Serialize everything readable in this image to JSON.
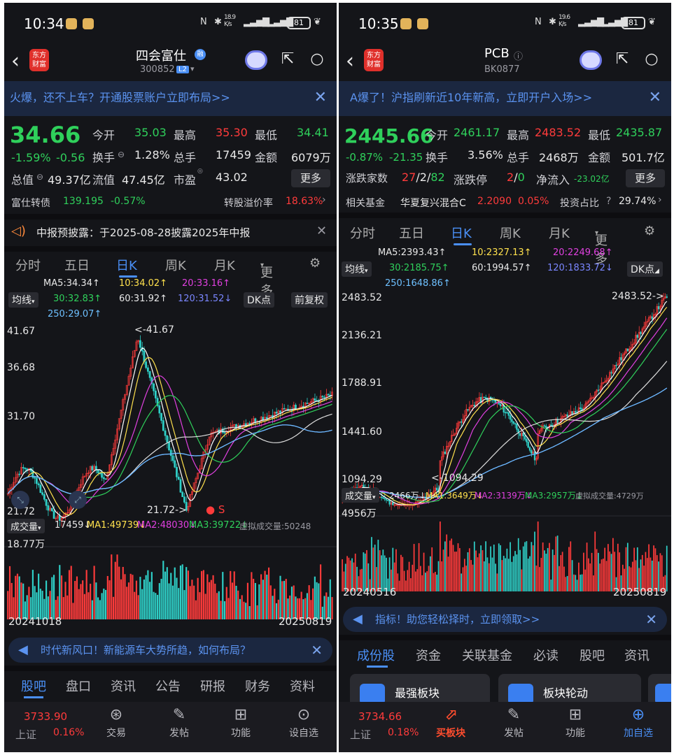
{
  "left": {
    "status": {
      "time": "10:34",
      "speed": "18.9\nK/s",
      "battery": "81"
    },
    "header": {
      "title": "四会富仕",
      "code": "300852",
      "badge_l2": "L2",
      "badge_rong": "融",
      "logo": "东方\n财富"
    },
    "banner": {
      "text": "火爆，还不上车？开通股票账户立即布局>>"
    },
    "quote": {
      "price": "34.66",
      "pct": "-1.59%",
      "chg": "-0.56",
      "open_label": "今开",
      "open": "35.03",
      "high_label": "最高",
      "high": "35.30",
      "low_label": "最低",
      "low": "34.41",
      "turnover_label": "换手",
      "turnover": "1.28%",
      "volume_label": "总手",
      "volume": "17459",
      "amount_label": "金额",
      "amount": "6079万",
      "mcap_label": "总值",
      "mcap": "49.37亿",
      "float_label": "流值",
      "float": "47.45亿",
      "pe_label": "市盈",
      "pe": "43.02",
      "more": "更多"
    },
    "bond": {
      "label": "富仕转债",
      "price": "139.195",
      "pct": "-0.57%",
      "premium_label": "转股溢价率",
      "premium": "18.63%"
    },
    "notice": {
      "text": "中报预披露：于2025-08-28披露2025年中报"
    },
    "tabs": [
      "分时",
      "五日",
      "日K",
      "周K",
      "月K",
      "更多"
    ],
    "ma": {
      "ma5": "MA5:34.34↑",
      "ma10": "10:34.02↑",
      "ma20": "20:33.16↑",
      "ma30": "30:32.83↑",
      "ma60": "60:31.92↑",
      "ma120": "120:31.52↓",
      "ma250": "250:29.07↑"
    },
    "pills": {
      "line": "均线",
      "dk": "DK点",
      "fq": "前复权"
    },
    "yaxis": [
      "41.67",
      "36.68",
      "31.70",
      "21.72"
    ],
    "hi_mark": "<-41.67",
    "lo_mark": "21.72->",
    "s_mark": "S",
    "vol": {
      "label": "成交量",
      "v": "17459↓",
      "ma1": "MA1:49739↓",
      "ma2": "MA2:48030↓",
      "ma3": "MA3:39722↓",
      "virt": "虚拟成交量:50248",
      "max": "18.77万"
    },
    "dates": {
      "start": "20241018",
      "end": "20250819"
    },
    "promo": "时代新风口！新能源车大势所趋，如何布局？",
    "bottom_tabs": [
      "股吧",
      "盘口",
      "资讯",
      "公告",
      "研报",
      "财务",
      "资料"
    ],
    "nav": {
      "index_name": "上证",
      "index_val": "3733.90",
      "index_pct": "0.16%",
      "items": [
        "交易",
        "发帖",
        "功能",
        "设自选"
      ]
    }
  },
  "right": {
    "status": {
      "time": "10:35",
      "speed": "19.6\nK/s",
      "battery": "81"
    },
    "header": {
      "title": "PCB",
      "code": "BK0877",
      "logo": "东方\n财富"
    },
    "banner": {
      "text": "A爆了！沪指刷新近10年新高，立即开户入场>>"
    },
    "quote": {
      "price": "2445.66",
      "pct": "-0.87%",
      "chg": "-21.35",
      "open_label": "今开",
      "open": "2461.17",
      "high_label": "最高",
      "high": "2483.52",
      "low_label": "最低",
      "low": "2435.87",
      "turnover_label": "换手",
      "turnover": "3.56%",
      "volume_label": "总手",
      "volume": "2468万",
      "amount_label": "金额",
      "amount": "501.7亿",
      "updown_label": "涨跌家数",
      "up": "27",
      "flat": "2",
      "down": "82",
      "limit_label": "涨跌停",
      "limit_up": "2",
      "limit_down": "0",
      "inflow_label": "净流入",
      "inflow": "-23.02亿",
      "more": "更多"
    },
    "fund": {
      "label": "相关基金",
      "name": "华夏复兴混合C",
      "price": "2.2090",
      "pct": "0.05%",
      "ratio_label": "投资占比",
      "ratio": "29.74%"
    },
    "tabs": [
      "分时",
      "五日",
      "日K",
      "周K",
      "月K",
      "更多"
    ],
    "ma": {
      "ma5": "MA5:2393.43↑",
      "ma10": "10:2327.13↑",
      "ma20": "20:2249.68↑",
      "ma30": "30:2185.75↑",
      "ma60": "60:1994.57↑",
      "ma120": "120:1833.72↓",
      "ma250": "250:1648.86↑"
    },
    "pills": {
      "line": "均线",
      "dk": "DK点"
    },
    "yaxis": [
      "2483.52",
      "2136.21",
      "1788.91",
      "1441.60",
      "1094.29"
    ],
    "hi_mark": "2483.52->",
    "lo_mark": "<-1094.29",
    "vol": {
      "label": "成交量",
      "v": "2466万↓",
      "ma1": "MA1:3649万↓",
      "ma2": "MA2:3139万↓",
      "ma3": "MA3:2957万↓",
      "virt": "虚拟成交量:4729万",
      "max": "4956万"
    },
    "dates": {
      "start": "20240516",
      "end": "20250819"
    },
    "promo": "指标！助您轻松择时，立即领取>>",
    "bottom_tabs": [
      "成份股",
      "资金",
      "关联基金",
      "必读",
      "股吧",
      "资讯"
    ],
    "cards": [
      "最强板块",
      "板块轮动"
    ],
    "nav": {
      "index_name": "上证",
      "index_val": "3734.66",
      "index_pct": "0.18%",
      "items": [
        "买板块",
        "发帖",
        "功能",
        "加自选"
      ]
    }
  },
  "colors": {
    "up": "#ff3b3b",
    "down": "#2fd05b",
    "accent": "#4a8ff5",
    "bg": "#141519",
    "ma5": "#ffffff",
    "ma10": "#ffe14d",
    "ma20": "#e040e0",
    "ma30": "#2fd05b",
    "ma60": "#dddddd",
    "ma120": "#5a6cff",
    "ma250": "#6ec0ff"
  }
}
